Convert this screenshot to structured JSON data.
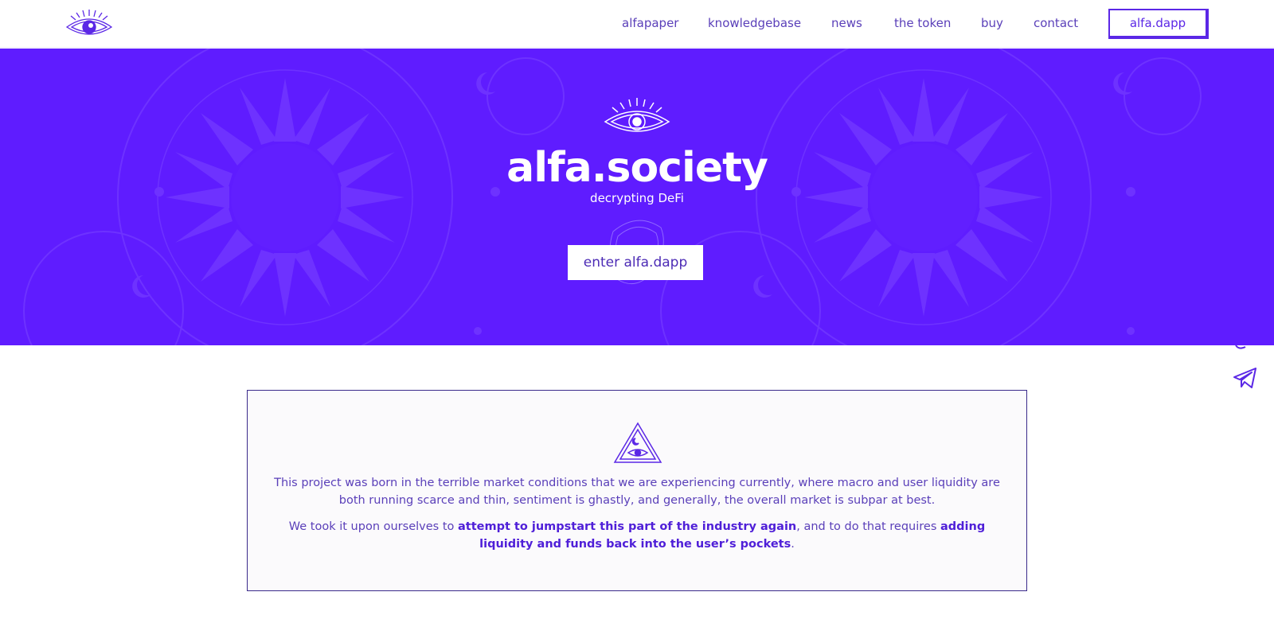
{
  "header": {
    "logo_icon": "eye-logo-icon",
    "nav": [
      {
        "label": "alfapaper"
      },
      {
        "label": "knowledgebase"
      },
      {
        "label": "news"
      },
      {
        "label": "the token"
      },
      {
        "label": "buy"
      },
      {
        "label": "contact"
      }
    ],
    "dapp_button": "alfa.dapp"
  },
  "hero": {
    "title": "alfa.society",
    "subtitle": "decrypting DeFi",
    "cta": "enter alfa.dapp",
    "background_color": "#5f1cff"
  },
  "social": {
    "icons": [
      "link-icon",
      "telegram-icon"
    ]
  },
  "card": {
    "icon": "pyramid-eye-icon",
    "p1": "This project was born in the terrible market conditions that we are experiencing currently, where macro and user liquidity are both running scarce and thin, sentiment is ghastly, and generally, the overall market is subpar at best.",
    "p2_a": "We took it upon ourselves to ",
    "p2_b": "attempt to jumpstart this part of the industry again",
    "p2_c": ", and to do that requires ",
    "p2_d": "adding liquidity and funds back into the user’s pockets",
    "p2_e": "."
  },
  "colors": {
    "accent": "#5b27e6",
    "text": "#5a3fb9",
    "hero": "#5f1cff"
  }
}
